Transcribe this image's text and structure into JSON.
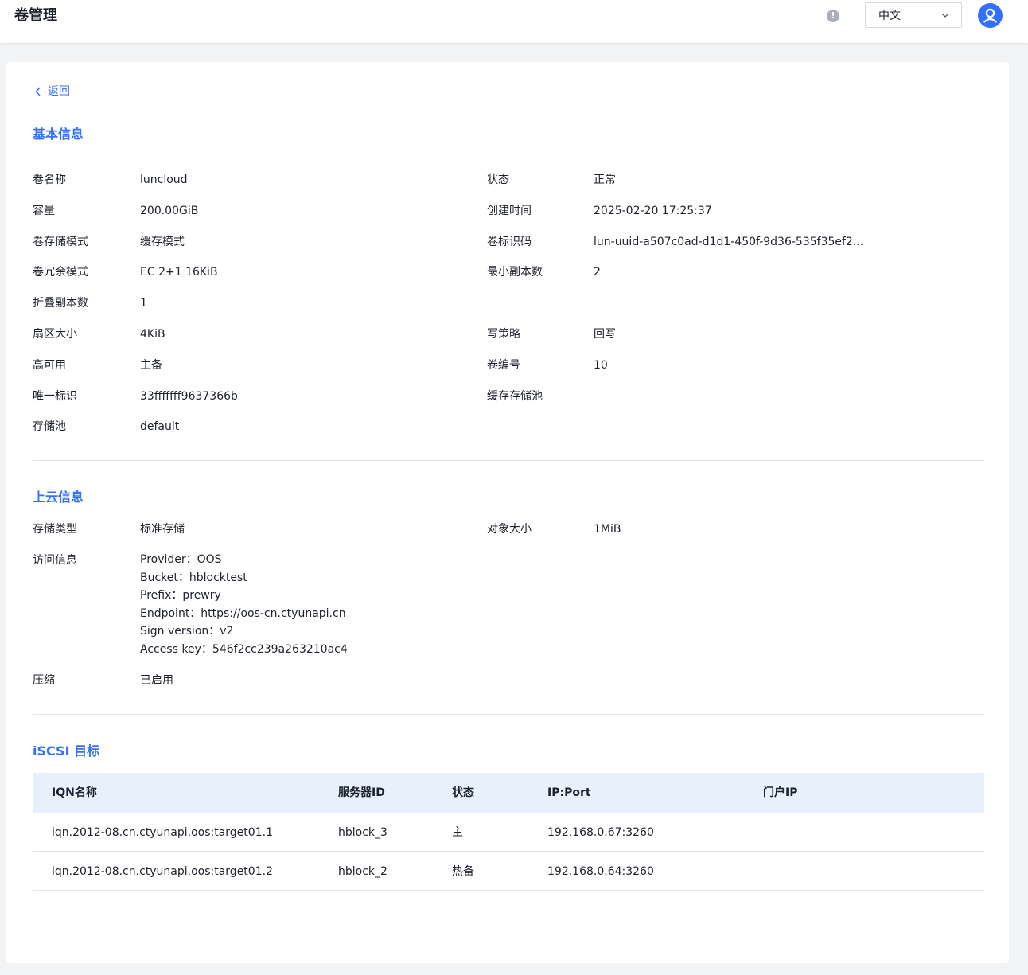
{
  "header": {
    "title": "卷管理",
    "language": "中文",
    "icons": {
      "info": "info-circle-icon",
      "dropdown": "chevron-down-icon",
      "user": "user-avatar-icon"
    }
  },
  "back": {
    "label": "返回"
  },
  "basic": {
    "title": "基本信息",
    "left": [
      {
        "label": "卷名称",
        "value": "luncloud"
      },
      {
        "label": "容量",
        "value": "200.00GiB"
      },
      {
        "label": "卷存储模式",
        "value": "缓存模式"
      },
      {
        "label": "卷冗余模式",
        "value": "EC 2+1 16KiB"
      },
      {
        "label": "折叠副本数",
        "value": "1"
      },
      {
        "label": "扇区大小",
        "value": "4KiB"
      },
      {
        "label": "高可用",
        "value": "主备"
      },
      {
        "label": "唯一标识",
        "value": "33fffffff9637366b"
      },
      {
        "label": "存储池",
        "value": "default"
      }
    ],
    "right": [
      {
        "label": "状态",
        "value": "正常"
      },
      {
        "label": "创建时间",
        "value": "2025-02-20 17:25:37"
      },
      {
        "label": "卷标识码",
        "value": "lun-uuid-a507c0ad-d1d1-450f-9d36-535f35ef2..."
      },
      {
        "label": "最小副本数",
        "value": "2"
      },
      {
        "label": "写策略",
        "value": "回写"
      },
      {
        "label": "卷编号",
        "value": "10"
      },
      {
        "label": "缓存存储池",
        "value": ""
      }
    ]
  },
  "cloud": {
    "title": "上云信息",
    "storage_type_label": "存储类型",
    "storage_type_value": "标准存储",
    "object_size_label": "对象大小",
    "object_size_value": "1MiB",
    "access_label": "访问信息",
    "access_lines": [
      "Provider：OOS",
      "Bucket：hblocktest",
      "Prefix：prewry",
      "Endpoint：https://oos-cn.ctyunapi.cn",
      "Sign version：v2",
      "Access key：546f2cc239a263210ac4"
    ],
    "compress_label": "压缩",
    "compress_value": "已启用"
  },
  "iscsi": {
    "title": "iSCSI 目标",
    "columns": [
      "IQN名称",
      "服务器ID",
      "状态",
      "IP:Port",
      "门户IP"
    ],
    "rows": [
      [
        "iqn.2012-08.cn.ctyunapi.oos:target01.1",
        "hblock_3",
        "主",
        "192.168.0.67:3260",
        ""
      ],
      [
        "iqn.2012-08.cn.ctyunapi.oos:target01.2",
        "hblock_2",
        "热备",
        "192.168.0.64:3260",
        ""
      ]
    ]
  },
  "colors": {
    "accent": "#3370ff",
    "table_header_bg": "#e8f0fc",
    "page_bg": "#f2f3f5"
  }
}
